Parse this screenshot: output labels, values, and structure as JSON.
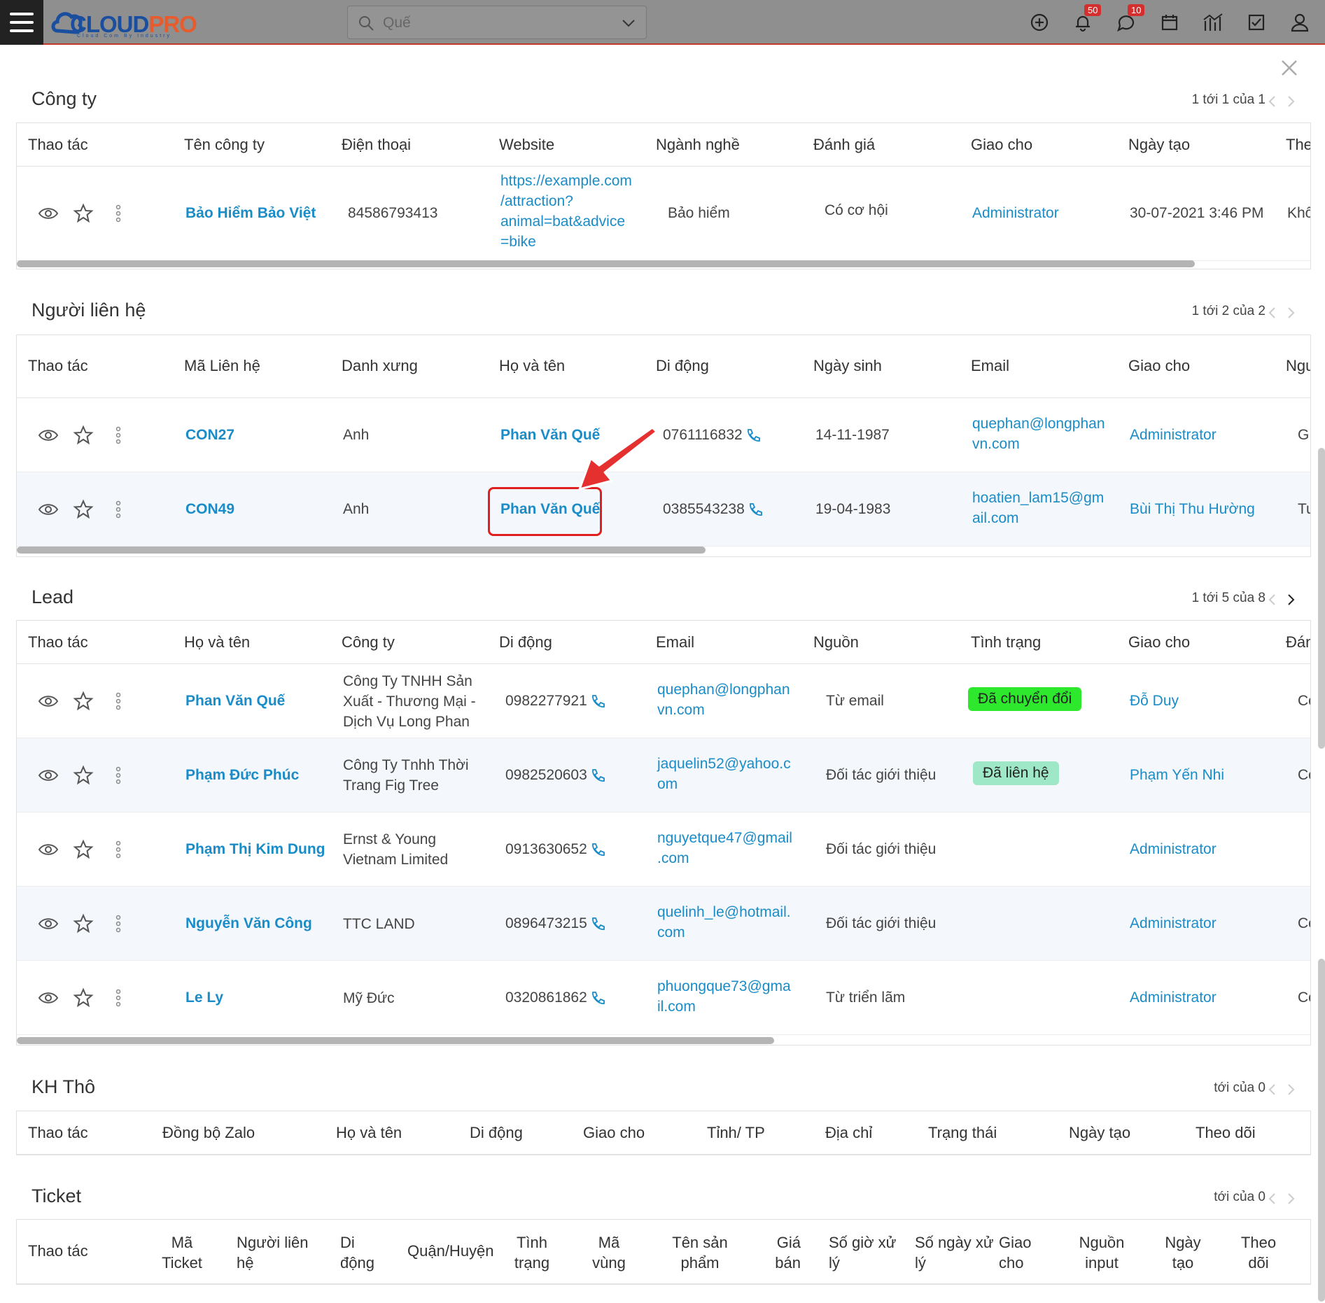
{
  "header": {
    "logo_text_a": "CLOUD",
    "logo_text_b": "PRO",
    "logo_sub": "Cloud Com By Industry",
    "search_value": "Quế",
    "notifications_count": "50",
    "messages_count": "10"
  },
  "icons": [
    "menu-icon",
    "search-icon",
    "chevron-down-icon",
    "plus-circle-icon",
    "bell-icon",
    "chat-icon",
    "calendar-icon",
    "chart-icon",
    "checkbox-icon",
    "user-icon",
    "close-icon",
    "eye-icon",
    "star-icon",
    "more-vertical-icon",
    "phone-icon"
  ],
  "company": {
    "title": "Công ty",
    "pager": "1 tới 1 của 1",
    "headers": [
      "Thao tác",
      "Tên công ty",
      "Điện thoại",
      "Website",
      "Ngành nghề",
      "Đánh giá",
      "Giao cho",
      "Ngày tạo",
      "The"
    ],
    "rows": [
      {
        "name": "Bảo Hiểm Bảo Việt",
        "phone": "84586793413",
        "website_1": "https://example.com",
        "website_2": "/attraction?",
        "website_3": "animal=bat&advice",
        "website_4": "=bike",
        "industry": "Bảo hiểm",
        "rating": "Có cơ hội",
        "assigned": "Administrator",
        "created": "30-07-2021 3:46 PM",
        "extra": "Khô"
      }
    ]
  },
  "contacts": {
    "title": "Người liên hệ",
    "pager": "1 tới 2 của 2",
    "headers": [
      "Thao tác",
      "Mã Liên hệ",
      "Danh xưng",
      "Họ và tên",
      "Di động",
      "Ngày sinh",
      "Email",
      "Giao cho",
      "Ngư"
    ],
    "rows": [
      {
        "code": "CON27",
        "salutation": "Anh",
        "name": "Phan Văn Quế",
        "mobile": "0761116832",
        "dob": "14-11-1987",
        "email_1": "quephan@longphan",
        "email_2": "vn.com",
        "assigned": "Administrator",
        "extra": "G"
      },
      {
        "code": "CON49",
        "salutation": "Anh",
        "name": "Phan Văn Quế",
        "mobile": "0385543238",
        "dob": "19-04-1983",
        "email_1": "hoatien_lam15@gm",
        "email_2": "ail.com",
        "assigned": "Bùi Thị Thu Hường",
        "extra": "Tu"
      }
    ]
  },
  "leads": {
    "title": "Lead",
    "pager": "1 tới 5 của 8",
    "headers": [
      "Thao tác",
      "Họ và tên",
      "Công ty",
      "Di động",
      "Email",
      "Nguồn",
      "Tình trạng",
      "Giao cho",
      "Đán"
    ],
    "rows": [
      {
        "name": "Phan Văn Quế",
        "company_1": "Công Ty TNHH Sản",
        "company_2": "Xuất - Thương Mại -",
        "company_3": "Dịch Vụ Long Phan",
        "mobile": "0982277921",
        "email_1": "quephan@longphan",
        "email_2": "vn.com",
        "source": "Từ email",
        "status": "Đã chuyển đổi",
        "assigned": "Đỗ Duy",
        "extra": "Cơ"
      },
      {
        "name": "Phạm Đức Phúc",
        "company_1": "Công Ty Tnhh Thời",
        "company_2": "Trang Fig Tree",
        "company_3": "",
        "mobile": "0982520603",
        "email_1": "jaquelin52@yahoo.c",
        "email_2": "om",
        "source": "Đối tác giới thiệu",
        "status": "Đã liên hệ",
        "assigned": "Phạm Yến Nhi",
        "extra": "Cơ"
      },
      {
        "name": "Phạm Thị Kim Dung",
        "company_1": "Ernst & Young",
        "company_2": "Vietnam Limited",
        "company_3": "",
        "mobile": "0913630652",
        "email_1": "nguyetque47@gmail",
        "email_2": ".com",
        "source": "Đối tác giới thiệu",
        "status": "",
        "assigned": "Administrator",
        "extra": ""
      },
      {
        "name": "Nguyễn Văn Công",
        "company_1": "TTC LAND",
        "company_2": "",
        "company_3": "",
        "mobile": "0896473215",
        "email_1": "quelinh_le@hotmail.",
        "email_2": "com",
        "source": "Đối tác giới thiệu",
        "status": "",
        "assigned": "Administrator",
        "extra": "Cơ"
      },
      {
        "name": "Le Ly",
        "company_1": "Mỹ Đức",
        "company_2": "",
        "company_3": "",
        "mobile": "0320861862",
        "email_1": "phuongque73@gma",
        "email_2": "il.com",
        "source": "Từ triển lãm",
        "status": "",
        "assigned": "Administrator",
        "extra": "Cơ"
      }
    ]
  },
  "raw_customers": {
    "title": "KH Thô",
    "pager": "tới của 0",
    "headers": [
      "Thao tác",
      "Đồng bộ Zalo",
      "Họ và tên",
      "Di động",
      "Giao cho",
      "Tỉnh/ TP",
      "Địa chỉ",
      "Trạng thái",
      "Ngày tạo",
      "Theo dõi"
    ]
  },
  "tickets": {
    "title": "Ticket",
    "pager": "tới của 0",
    "headers": [
      "Thao tác",
      "Mã Ticket",
      "Người liên hệ",
      "Di động",
      "Quận/Huyện",
      "Tình trạng",
      "Mã vùng",
      "Tên sản phẩm",
      "Giá bán",
      "Số giờ xử lý",
      "Số ngày xử lý",
      "Giao cho",
      "Nguồn input",
      "Ngày tạo",
      "Theo dõi"
    ]
  },
  "colors": {
    "link": "#1a8cc8",
    "status_converted": "#2ee82e",
    "status_contacted": "#9ee8c8",
    "highlight": "#e02020"
  }
}
